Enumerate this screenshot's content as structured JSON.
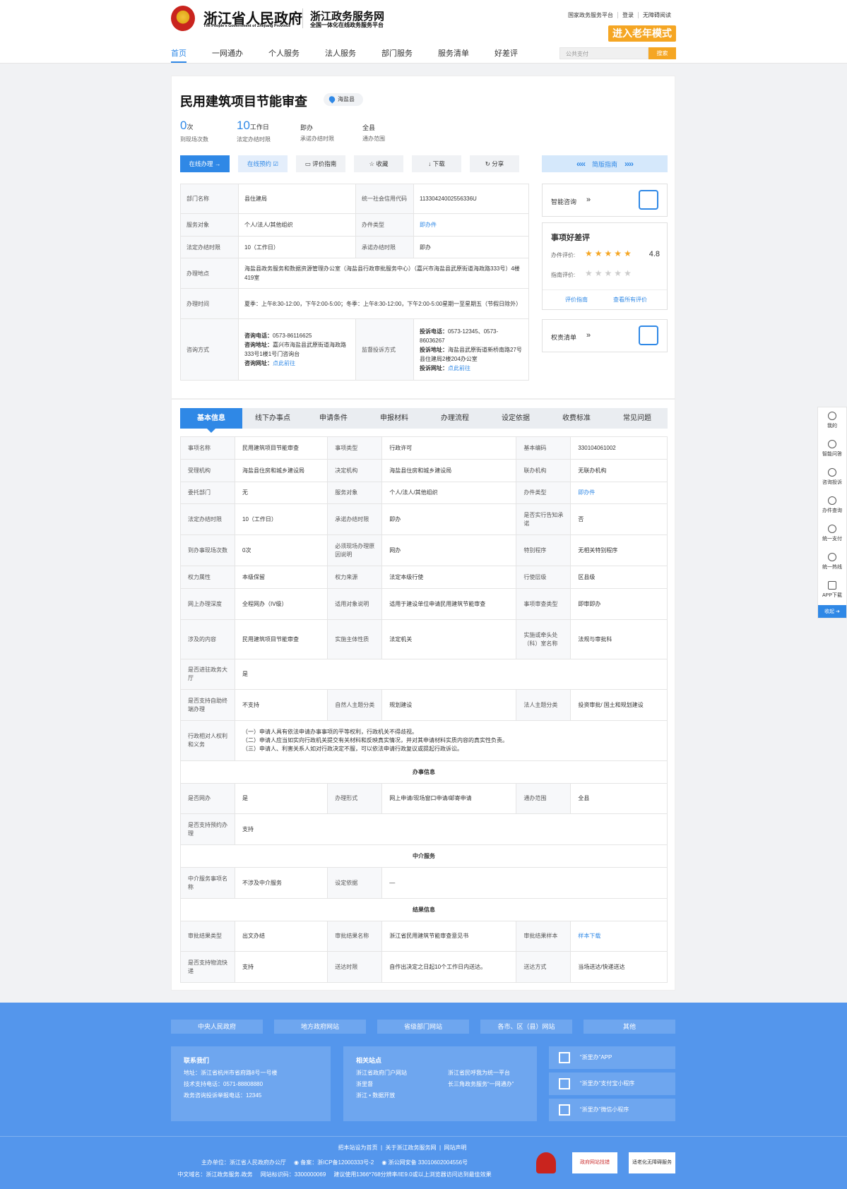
{
  "header": {
    "site_name": "浙江省人民政府",
    "site_name_en": "The People's Government of Zhejiang Province",
    "service_name": "浙江政务服务网",
    "service_sub": "全国一体化在线政务服务平台",
    "top_links": [
      "国家政务服务平台",
      "登录",
      "无障碍阅读"
    ],
    "elder_mode": "进入老年模式",
    "nav": [
      "首页",
      "一网通办",
      "个人服务",
      "法人服务",
      "部门服务",
      "服务清单",
      "好差评"
    ],
    "search_placeholder": "公共支付",
    "search_button": "搜索"
  },
  "item": {
    "title": "民用建筑项目节能审查",
    "location": "海盐县",
    "stats": [
      {
        "value": "0",
        "unit": "次",
        "label": "到现场次数"
      },
      {
        "value": "10",
        "unit": "工作日",
        "label": "法定办结时限"
      },
      {
        "value": "",
        "unit": "即办",
        "label": "承诺办结时限"
      },
      {
        "value": "",
        "unit": "全县",
        "label": "通办范围"
      }
    ],
    "buttons": [
      "在线办理",
      "在线预约",
      "评价指南",
      "收藏",
      "下载",
      "分享"
    ],
    "guide": "简版指南"
  },
  "summary": {
    "dept_k": "部门名称",
    "dept_v": "县住建局",
    "credit_k": "统一社会信用代码",
    "credit_v": "11330424002556336U",
    "target_k": "服务对象",
    "target_v": "个人/法人/其他组织",
    "type_k": "办件类型",
    "type_v": "即办件",
    "legal_k": "法定办结时限",
    "legal_v": "10（工作日）",
    "promise_k": "承诺办结时限",
    "promise_v": "即办",
    "addr_k": "办理地点",
    "addr_v": "海盐县政务服务和数据资源管理办公室（海盐县行政审批服务中心）（嘉兴市海盐县武原街道海政路333号）4楼419室",
    "time_k": "办理时间",
    "time_v": "夏季：上午8:30-12:00，下午2:00-5:00；冬季：上午8:30-12:00，下午2:00-5:00星期一至星期五（节假日除外）",
    "consult_k": "咨询方式",
    "consult_tel_l": "咨询电话：",
    "consult_tel": "0573-86116625",
    "consult_addr_l": "咨询地址：",
    "consult_addr": "嘉兴市海盐县武原街道海政路333号1楼1号门咨询台",
    "consult_web_l": "咨询网址：",
    "consult_web": "点此前往",
    "supervise_k": "监督投诉方式",
    "comp_tel_l": "投诉电话：",
    "comp_tel": "0573-12345、0573-86036267",
    "comp_addr_l": "投诉地址：",
    "comp_addr": "海盐县武原街道新桥南路27号县住建局2楼204办公室",
    "comp_web_l": "投诉网址：",
    "comp_web": "点此前往"
  },
  "sidebar": {
    "consult": "智能咨询",
    "rating_title": "事项好差评",
    "rating_label": "办件评价:",
    "rating_score": "4.8",
    "rating_stars": 5,
    "guide_rating_label": "指南评价:",
    "guide_stars": 0,
    "rate_guide": "评价指南",
    "view_all": "查看所有评价",
    "power": "权责清单"
  },
  "tabs": [
    "基本信息",
    "线下办事点",
    "申请条件",
    "申报材料",
    "办理流程",
    "设定依据",
    "收费标准",
    "常见问题"
  ],
  "basic": {
    "r1": [
      "事项名称",
      "民用建筑项目节能审查",
      "事项类型",
      "行政许可",
      "基本编码",
      "330104061002"
    ],
    "r2": [
      "受理机构",
      "海盐县住房和城乡建设局",
      "决定机构",
      "海盐县住房和城乡建设局",
      "联办机构",
      "无联办机构"
    ],
    "r3": [
      "委托部门",
      "无",
      "服务对象",
      "个人/法人/其他组织",
      "办件类型",
      "即办件"
    ],
    "r4": [
      "法定办结时限",
      "10（工作日）",
      "承诺办结时限",
      "即办",
      "是否实行告知承诺",
      "否"
    ],
    "r5": [
      "到办事现场次数",
      "0次",
      "必须现场办理原因说明",
      "网办",
      "特别程序",
      "无相关特别程序"
    ],
    "r6": [
      "权力属性",
      "本级保留",
      "权力来源",
      "法定本级行使",
      "行使层级",
      "区县级"
    ],
    "r7": [
      "网上办理深度",
      "全程网办（IV级）",
      "适用对象说明",
      "适用于建设单位申请民用建筑节能审查",
      "事项审查类型",
      "即审即办"
    ],
    "r8": [
      "涉及的内容",
      "民用建筑项目节能审查",
      "实施主体性质",
      "法定机关",
      "实施或牵头处（科）室名称",
      "法规与审批科"
    ],
    "r9": [
      "是否进驻政务大厅",
      "是"
    ],
    "r10": [
      "是否支持自助终端办理",
      "不支持",
      "自然人主题分类",
      "规划建设",
      "法人主题分类",
      "投资审批/ 国土和规划建设"
    ],
    "r11_k": "行政相对人权利和义务",
    "r11_v": [
      "（一）申请人具有依法申请办事事项的平等权利，行政机关不得歧视。",
      "（二）申请人应当如实向行政机关提交有关材料和反映真实情况，并对其申请材料实质内容的真实性负责。",
      "（三）申请人、利害关系人如对行政决定不服，可以依法申请行政复议或提起行政诉讼。"
    ],
    "sec1": "办事信息",
    "r12": [
      "是否网办",
      "是",
      "办理形式",
      "网上申请/现场窗口申请/邮寄申请",
      "通办范围",
      "全县"
    ],
    "r13": [
      "是否支持预约办理",
      "支持"
    ],
    "sec2": "中介服务",
    "r14": [
      "中介服务事项名称",
      "不涉及中介服务",
      "设定依据",
      "—"
    ],
    "sec3": "结果信息",
    "r15": [
      "审批结果类型",
      "出文办结",
      "审批结果名称",
      "浙江省民用建筑节能审查意见书",
      "审批结果样本",
      "样本下载"
    ],
    "r16": [
      "是否支持物流快递",
      "支持",
      "送达时限",
      "自作出决定之日起10个工作日内送达。",
      "送达方式",
      "当场送达/快递送达"
    ]
  },
  "rightbar": [
    "我的",
    "智能问答",
    "咨询投诉",
    "办件查询",
    "统一支付",
    "统一热线",
    "APP下载",
    "收起"
  ],
  "footer": {
    "links": [
      "中央人民政府",
      "地方政府网站",
      "省级部门网站",
      "各市、区（县）网站",
      "其他"
    ],
    "contact_title": "联系我们",
    "contact": [
      "地址：浙江省杭州市省府路8号一号楼",
      "技术支持电话：0571-88808880",
      "政务咨询投诉举报电话：12345"
    ],
    "related_title": "相关站点",
    "related": [
      "浙江省政府门户网站",
      "浙江省民呼我为统一平台",
      "浙里督",
      "长三角政务服务“一网通办”",
      "浙江 • 数据开放"
    ],
    "apps": [
      "“浙里办”APP",
      "“浙里办”支付宝小程序",
      "“浙里办”微信小程序"
    ],
    "bottom_links": [
      "把本站设为首页",
      "关于浙江政务服务网",
      "网站声明"
    ],
    "line2": [
      "主办单位：浙江省人民政府办公厅",
      "备案：浙ICP备12000333号-2",
      "浙公网安备 33010602004556号"
    ],
    "line3": [
      "中文域名：浙江政务服务.政务",
      "网站标识码：3300000069",
      "建议使用1366*768分辨率/IE9.0或以上浏览器访问达到最佳效果"
    ],
    "badge1": "政府网站找错",
    "badge2": "适老化无障碍服务"
  }
}
